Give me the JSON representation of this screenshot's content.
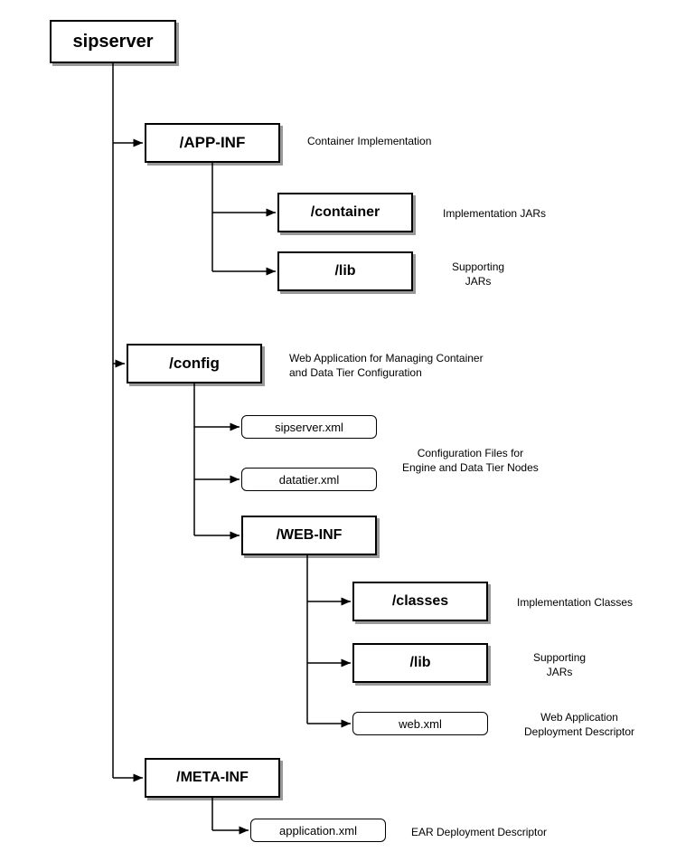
{
  "root": {
    "label": "sipserver"
  },
  "appinf": {
    "label": "/APP-INF",
    "desc": "Container Implementation",
    "children": {
      "container": {
        "label": "/container",
        "desc": "Implementation JARs"
      },
      "lib": {
        "label": "/lib",
        "desc": "Supporting\nJARs"
      }
    }
  },
  "config": {
    "label": "/config",
    "desc": "Web Application for Managing Container\nand Data Tier Configuration",
    "files": {
      "sipserver": {
        "label": "sipserver.xml"
      },
      "datatier": {
        "label": "datatier.xml"
      },
      "filesdesc": "Configuration Files for\nEngine and Data Tier Nodes"
    },
    "webinf": {
      "label": "/WEB-INF",
      "children": {
        "classes": {
          "label": "/classes",
          "desc": "Implementation Classes"
        },
        "lib": {
          "label": "/lib",
          "desc": "Supporting\nJARs"
        },
        "webxml": {
          "label": "web.xml",
          "desc": "Web Application\nDeployment Descriptor"
        }
      }
    }
  },
  "metainf": {
    "label": "/META-INF",
    "children": {
      "appxml": {
        "label": "application.xml",
        "desc": "EAR Deployment Descriptor"
      }
    }
  }
}
